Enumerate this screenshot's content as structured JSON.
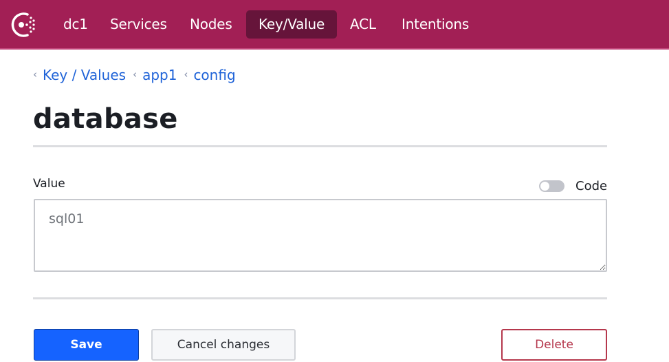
{
  "nav": {
    "logo_icon": "consul-logo-icon",
    "items": [
      {
        "label": "dc1",
        "active": false
      },
      {
        "label": "Services",
        "active": false
      },
      {
        "label": "Nodes",
        "active": false
      },
      {
        "label": "Key/Value",
        "active": true
      },
      {
        "label": "ACL",
        "active": false
      },
      {
        "label": "Intentions",
        "active": false
      }
    ]
  },
  "breadcrumb": [
    {
      "label": "Key / Values"
    },
    {
      "label": "app1"
    },
    {
      "label": "config"
    }
  ],
  "page": {
    "title": "database"
  },
  "form": {
    "value_label": "Value",
    "code_toggle_label": "Code",
    "code_toggle_on": false,
    "value": "sql01"
  },
  "actions": {
    "save_label": "Save",
    "cancel_label": "Cancel changes",
    "delete_label": "Delete"
  },
  "colors": {
    "brand": "#a21f55",
    "nav_active": "#66143a",
    "link": "#1f63d8",
    "primary": "#1563ff",
    "danger": "#b5374c"
  }
}
